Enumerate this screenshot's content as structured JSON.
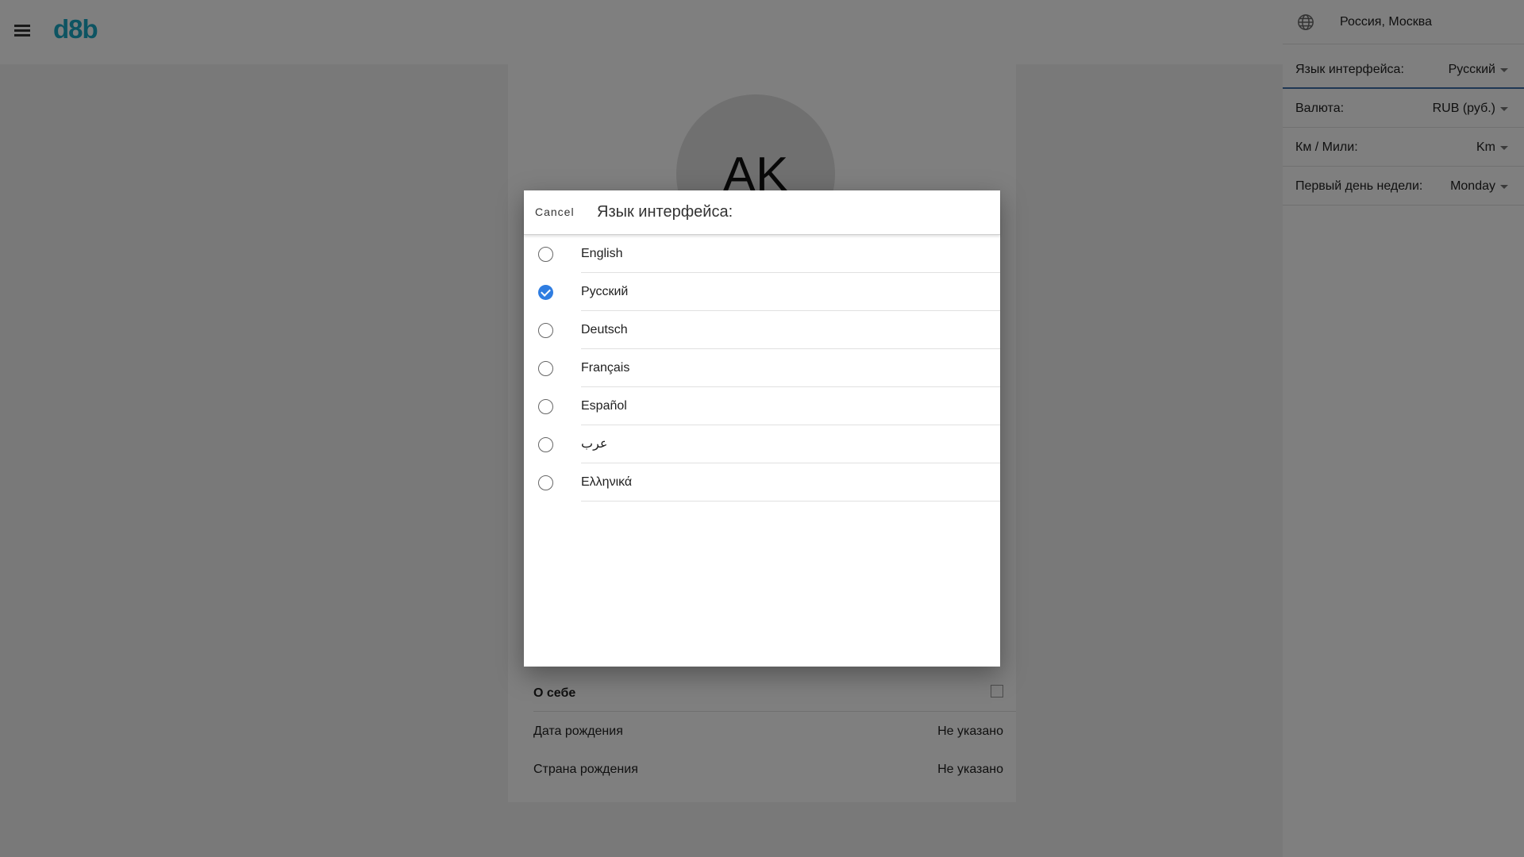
{
  "app": {
    "logo": "d8b"
  },
  "profile": {
    "avatar_initials": "AK",
    "about_title": "О себе",
    "rows": [
      {
        "label": "Дата рождения",
        "value": "Не указано"
      },
      {
        "label": "Страна рождения",
        "value": "Не указано"
      }
    ]
  },
  "settings": {
    "location": "Россия, Москва",
    "rows": [
      {
        "label": "Язык интерфейса:",
        "value": "Русский"
      },
      {
        "label": "Валюта:",
        "value": "RUB (руб.)"
      },
      {
        "label": "Км / Мили:",
        "value": "Km"
      },
      {
        "label": "Первый день недели:",
        "value": "Monday"
      }
    ]
  },
  "dialog": {
    "cancel_label": "Cancel",
    "title": "Язык интерфейса:",
    "languages": [
      {
        "label": "English",
        "selected": false
      },
      {
        "label": "Русский",
        "selected": true
      },
      {
        "label": "Deutsch",
        "selected": false
      },
      {
        "label": "Français",
        "selected": false
      },
      {
        "label": "Español",
        "selected": false
      },
      {
        "label": "عرب",
        "selected": false
      },
      {
        "label": "Ελληνικά",
        "selected": false
      }
    ]
  },
  "colors": {
    "brand": "#1aa9c4",
    "accent": "#2f7de1",
    "active_underline": "#3f6fa8"
  }
}
